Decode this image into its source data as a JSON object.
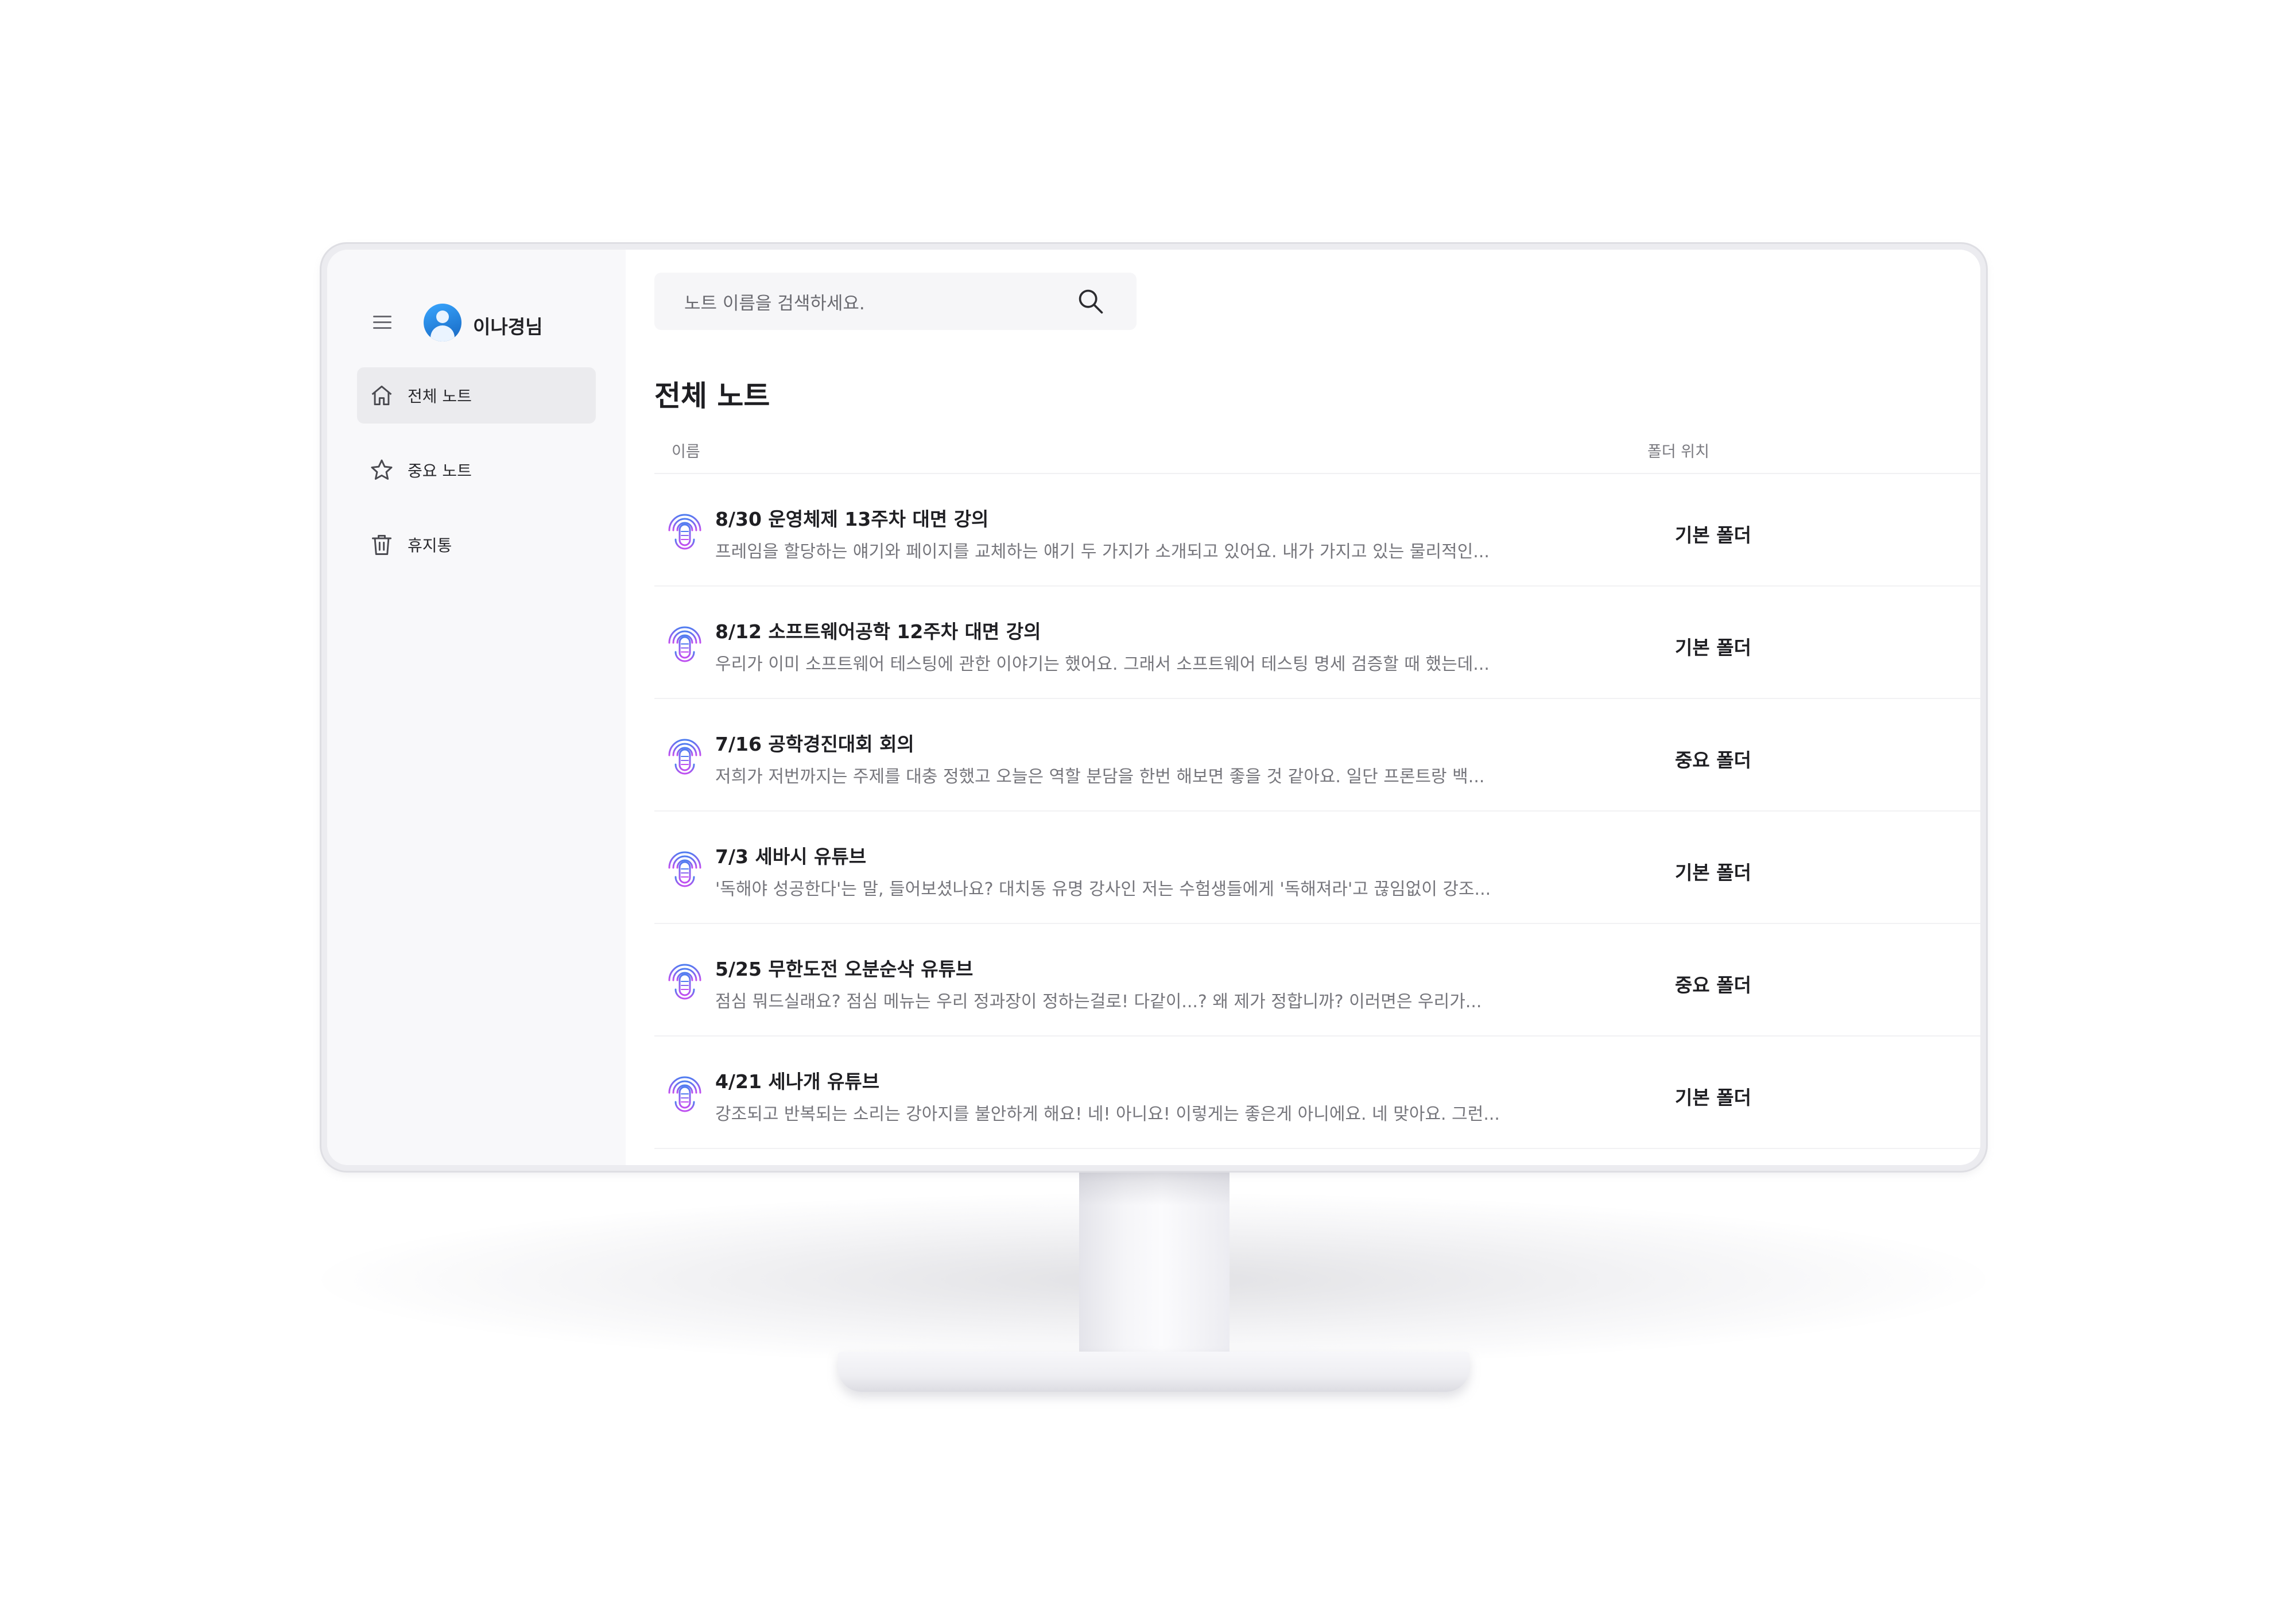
{
  "user": {
    "name": "이나경님"
  },
  "sidebar": {
    "items": [
      {
        "label": "전체 노트",
        "icon": "home-icon",
        "active": true
      },
      {
        "label": "중요 노트",
        "icon": "star-icon",
        "active": false
      },
      {
        "label": "휴지통",
        "icon": "trash-icon",
        "active": false
      }
    ]
  },
  "search": {
    "placeholder": "노트 이름을 검색하세요."
  },
  "main": {
    "title": "전체 노트",
    "columns": {
      "name": "이름",
      "folder": "폴더 위치"
    },
    "notes": [
      {
        "title": "8/30 운영체제 13주차 대면 강의",
        "preview": "프레임을 할당하는 얘기와 페이지를 교체하는 얘기 두 가지가 소개되고 있어요. 내가 가지고 있는 물리적인...",
        "folder": "기본 폴더"
      },
      {
        "title": "8/12 소프트웨어공학 12주차 대면 강의",
        "preview": "우리가 이미 소프트웨어 테스팅에 관한 이야기는 했어요. 그래서 소프트웨어 테스팅 명세 검증할 때 했는데...",
        "folder": "기본 폴더"
      },
      {
        "title": "7/16 공학경진대회 회의",
        "preview": "저희가 저번까지는 주제를 대충 정했고 오늘은 역할 분담을 한번 해보면 좋을 것 같아요. 일단 프론트랑 백...",
        "folder": "중요 폴더"
      },
      {
        "title": "7/3 세바시 유튜브",
        "preview": "'독해야 성공한다'는 말, 들어보셨나요? 대치동 유명 강사인 저는 수험생들에게 '독해져라'고 끊임없이 강조...",
        "folder": "기본 폴더"
      },
      {
        "title": "5/25 무한도전 오분순삭 유튜브",
        "preview": "점심 뭐드실래요? 점심 메뉴는 우리 정과장이 정하는걸로! 다같이...? 왜 제가 정합니까? 이러면은 우리가...",
        "folder": "중요 폴더"
      },
      {
        "title": "4/21 세나개 유튜브",
        "preview": "강조되고 반복되는 소리는 강아지를 불안하게 해요! 네! 아니요! 이렇게는 좋은게 아니에요. 네 맞아요. 그런...",
        "folder": "기본 폴더"
      }
    ]
  },
  "colors": {
    "icon_gradient_start": "#4f7df0",
    "icon_gradient_end": "#c24ef0",
    "active_nav_bg": "#ebebee"
  }
}
